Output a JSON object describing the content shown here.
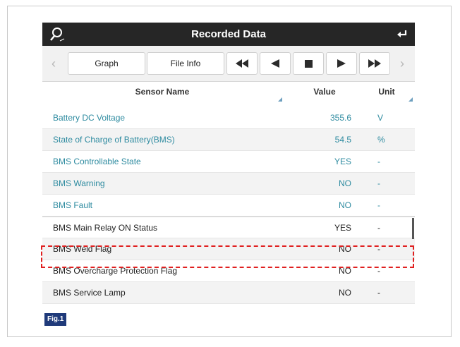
{
  "header": {
    "title": "Recorded Data",
    "search_icon": "search-icon",
    "back_icon": "undo-arrow-icon"
  },
  "toolbar": {
    "graph_label": "Graph",
    "fileinfo_label": "File Info",
    "controls": [
      "rewind",
      "prev",
      "stop",
      "play",
      "fast-forward"
    ]
  },
  "columns": {
    "name": "Sensor Name",
    "value": "Value",
    "unit": "Unit"
  },
  "rows": [
    {
      "name": "Battery DC Voltage",
      "value": "355.6",
      "unit": "V"
    },
    {
      "name": "State of Charge of Battery(BMS)",
      "value": "54.5",
      "unit": "%"
    },
    {
      "name": "BMS Controllable State",
      "value": "YES",
      "unit": "-"
    },
    {
      "name": "BMS Warning",
      "value": "NO",
      "unit": "-"
    },
    {
      "name": "BMS Fault",
      "value": "NO",
      "unit": "-"
    },
    {
      "name": "BMS Main Relay ON Status",
      "value": "YES",
      "unit": "-"
    },
    {
      "name": "BMS Weld Flag",
      "value": "NO",
      "unit": "-"
    },
    {
      "name": "BMS Overcharge Protection Flag",
      "value": "NO",
      "unit": "-"
    },
    {
      "name": "BMS Service Lamp",
      "value": "NO",
      "unit": "-"
    }
  ],
  "caption": "Fig.1",
  "colors": {
    "titlebar": "#262626",
    "teal_text": "#2e8ba0",
    "highlight": "#e02020",
    "caption_bg": "#1f3a7a"
  }
}
